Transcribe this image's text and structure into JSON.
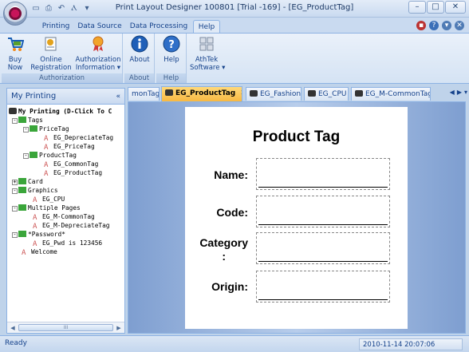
{
  "window": {
    "title": "Print Layout Designer 100801 [Trial -169] - [EG_ProductTag]",
    "min": "–",
    "max": "□",
    "close": "✕"
  },
  "ribbon_tabs": [
    "Printing",
    "Data Source",
    "Data Processing",
    "Help"
  ],
  "ribbon": {
    "groups": [
      {
        "label": "Authorization",
        "buttons": [
          {
            "label": "Buy\nNow",
            "icon": "cart-icon"
          },
          {
            "label": "Online\nRegistration",
            "icon": "registration-icon"
          },
          {
            "label": "Authorization\nInformation ▾",
            "icon": "ribbon-award-icon"
          }
        ]
      },
      {
        "label": "About",
        "buttons": [
          {
            "label": "About",
            "icon": "info-icon"
          }
        ]
      },
      {
        "label": "Help",
        "buttons": [
          {
            "label": "Help",
            "icon": "help-icon"
          }
        ]
      },
      {
        "label": "",
        "buttons": [
          {
            "label": "AthTek\nSoftware ▾",
            "icon": "grid-icon"
          }
        ]
      }
    ]
  },
  "left_panel": {
    "title": "My Printing",
    "tree": [
      {
        "label": "My Printing (D-Click To C",
        "bold": true
      },
      {
        "label": "Tags",
        "expander": "-"
      },
      {
        "label": "PriceTag",
        "expander": "-"
      },
      {
        "label": "EG_DepreciateTag"
      },
      {
        "label": "EG_PriceTag"
      },
      {
        "label": "ProductTag",
        "expander": "-"
      },
      {
        "label": "EG_CommonTag"
      },
      {
        "label": "EG_ProductTag"
      },
      {
        "label": "Card",
        "expander": "+"
      },
      {
        "label": "Graphics",
        "expander": "-"
      },
      {
        "label": "EG_CPU"
      },
      {
        "label": "Multiple Pages",
        "expander": "-"
      },
      {
        "label": "EG_M-CommonTag"
      },
      {
        "label": "EG_M-DepreciateTag"
      },
      {
        "label": "*Password*",
        "expander": "-"
      },
      {
        "label": "EG_Pwd is 123456"
      },
      {
        "label": "Welcome"
      }
    ],
    "scroll_thumb": "III"
  },
  "doc_tabs": [
    {
      "label": "monTag",
      "active": false
    },
    {
      "label": "EG_ProductTag",
      "active": true
    },
    {
      "label": "EG_Fashion",
      "active": false
    },
    {
      "label": "EG_CPU",
      "active": false
    },
    {
      "label": "EG_M-CommonTag",
      "active": false
    }
  ],
  "doc_tab_close": "✕",
  "doc_nav": [
    "◀",
    "▶",
    "▾"
  ],
  "label_page": {
    "title": "Product Tag",
    "fields": [
      "Name:",
      "Code:",
      "Category\n:",
      "Origin:"
    ]
  },
  "status": {
    "left": "Ready",
    "datetime": "2010-11-14 20:07:06"
  },
  "colors": {
    "accent": "#15428b",
    "active_tab": "#f7b842",
    "canvas": "#7e9ed0"
  }
}
